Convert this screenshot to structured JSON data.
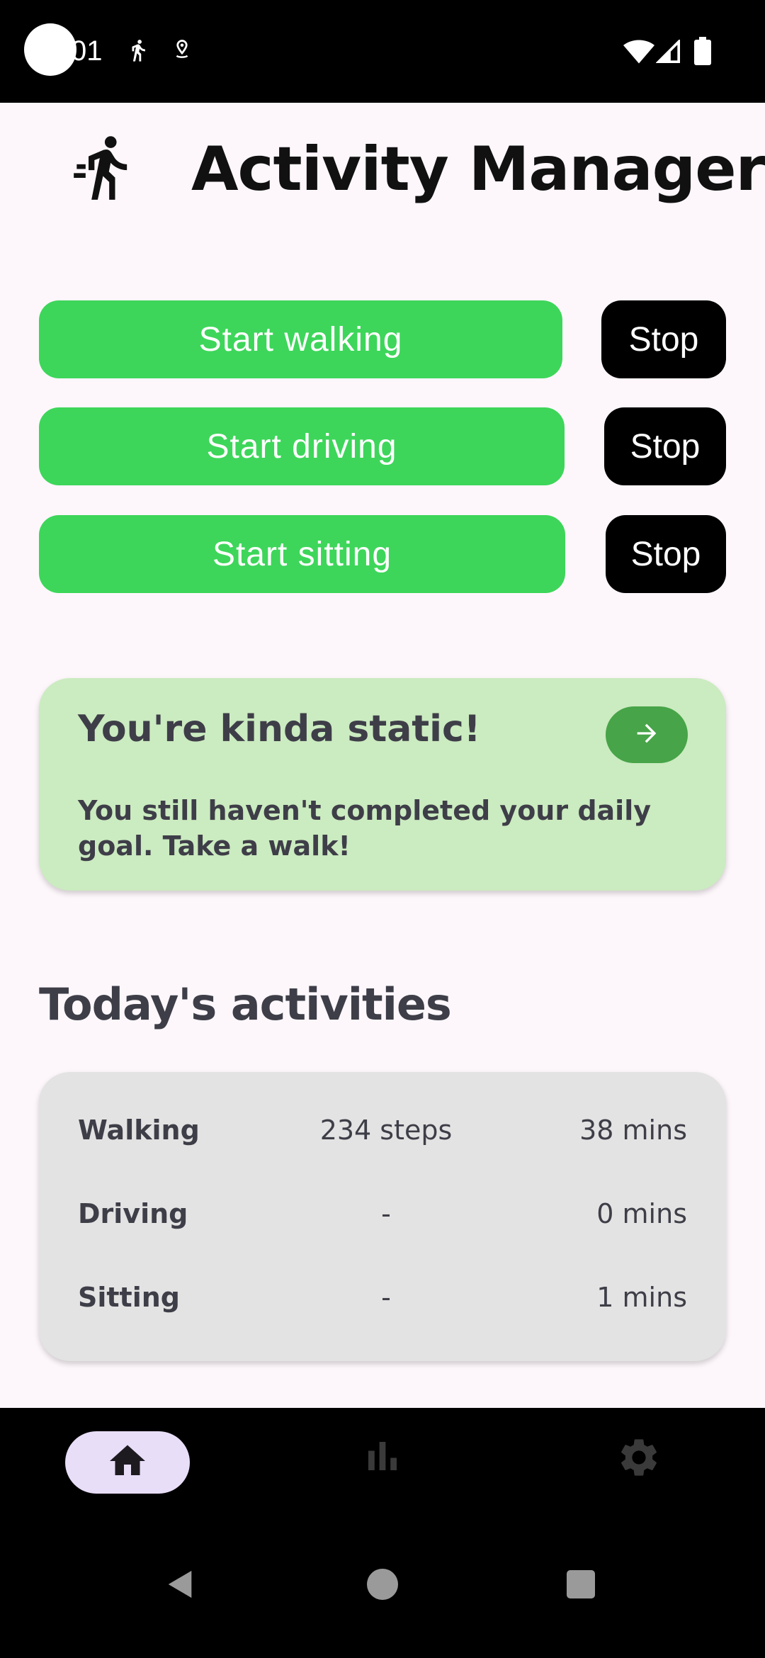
{
  "status_bar": {
    "time": "01",
    "icons": [
      "running-icon",
      "location-icon",
      "wifi-icon",
      "signal-icon",
      "battery-icon"
    ]
  },
  "header": {
    "title": "Activity Manager",
    "logo_icon": "running-man-icon"
  },
  "actions": [
    {
      "start_label": "Start walking",
      "stop_label": "Stop"
    },
    {
      "start_label": "Start driving",
      "stop_label": "Stop"
    },
    {
      "start_label": "Start sitting",
      "stop_label": "Stop"
    }
  ],
  "nudge": {
    "title": "You're kinda static!",
    "body": "You still haven't completed your daily goal. Take a walk!",
    "action_icon": "arrow-right-icon"
  },
  "activities": {
    "title": "Today's activities",
    "rows": [
      {
        "name": "Walking",
        "steps": "234  steps",
        "mins": "38  mins"
      },
      {
        "name": "Driving",
        "steps": "-",
        "mins": "0  mins"
      },
      {
        "name": "Sitting",
        "steps": "-",
        "mins": "1  mins"
      }
    ]
  },
  "bottom_nav": {
    "items": [
      "home-icon",
      "bar-chart-icon",
      "gear-icon"
    ],
    "selected": "home-icon"
  },
  "colors": {
    "start_button": "#3dd65a",
    "stop_button": "#000000",
    "nudge_card": "#cbebc0",
    "nudge_action": "#47a448",
    "activities_card": "#e3e3e3",
    "nav_selected_pill": "#e8def8",
    "background": "#fdf7fb"
  }
}
